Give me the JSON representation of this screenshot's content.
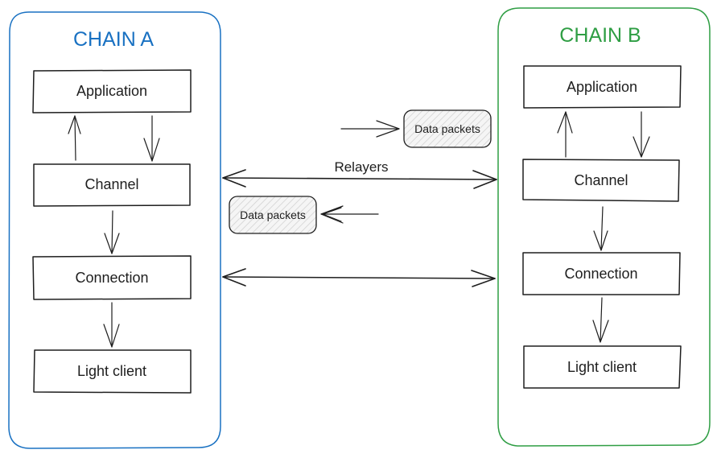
{
  "diagram": {
    "chains": [
      {
        "title": "CHAIN A",
        "color": "#1971c2",
        "layers": [
          "Application",
          "Channel",
          "Connection",
          "Light client"
        ],
        "light_client_fill": "#b2f2bb"
      },
      {
        "title": "CHAIN B",
        "color": "#2f9e44",
        "layers": [
          "Application",
          "Channel",
          "Connection",
          "Light client"
        ],
        "light_client_fill": "#a5d8ff"
      }
    ],
    "relayers_label": "Relayers",
    "packets": [
      {
        "label": "Data packets",
        "direction": "to-chain-b"
      },
      {
        "label": "Data packets",
        "direction": "to-chain-a"
      }
    ]
  }
}
